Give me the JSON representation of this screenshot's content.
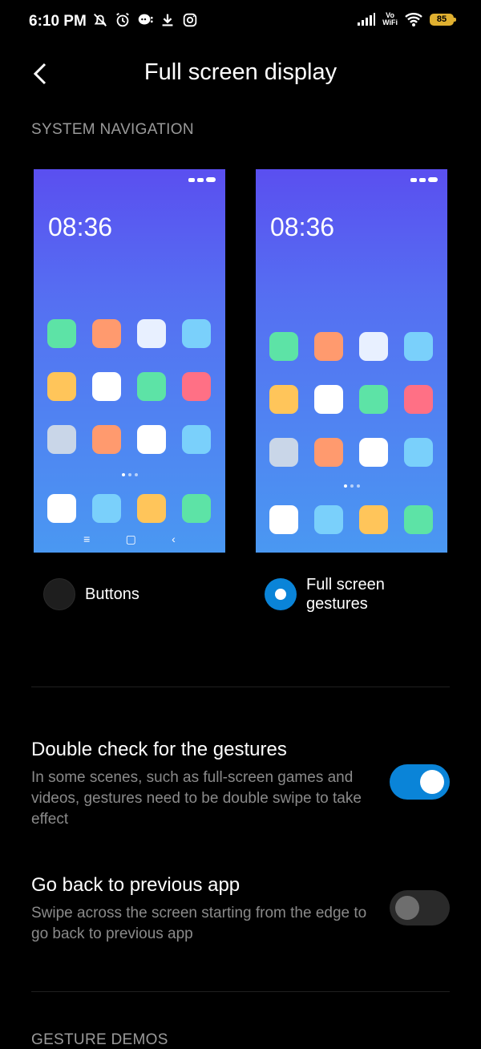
{
  "status_bar": {
    "time": "6:10 PM",
    "left_icons": [
      "mute-notifications-icon",
      "alarm-icon",
      "chat-icon",
      "download-icon",
      "instagram-icon"
    ],
    "vowifi_top": "Vo",
    "vowifi_bottom": "WiFi",
    "battery": "85",
    "colors": {
      "battery": "#e0b030"
    }
  },
  "header": {
    "back_icon": "chevron-left-icon",
    "title": "Full screen display"
  },
  "system_navigation": {
    "label": "SYSTEM NAVIGATION",
    "previews": [
      {
        "clock": "08:36",
        "nav_keys": [
          "≡",
          "▢",
          "‹"
        ]
      },
      {
        "clock": "08:36"
      }
    ],
    "options": [
      {
        "label": "Buttons",
        "selected": false
      },
      {
        "label_line1": "Full screen",
        "label_line2": "gestures",
        "selected": true
      }
    ]
  },
  "settings": [
    {
      "title": "Double check for the gestures",
      "description": "In some scenes, such as full-screen games and videos, gestures need to be double swipe to take effect",
      "enabled": true
    },
    {
      "title": "Go back to previous app",
      "description": "Swipe across the screen starting from the edge to go back to previous app",
      "enabled": false
    }
  ],
  "gesture_demos": {
    "label": "GESTURE DEMOS"
  },
  "colors": {
    "accent": "#0a84d8",
    "background": "#000000",
    "secondary_text": "#8a8a8a"
  },
  "app_icon_colors": [
    "#5de3a6",
    "#ff9a6e",
    "#e8f0ff",
    "#7ad0fb",
    "#ffc55a",
    "#ffffff",
    "#5de3a6",
    "#ff7085",
    "#c9d6e8",
    "#ff9a6e",
    "#ffffff",
    "#7ad0fb",
    "#ffffff",
    "#7ad0fb",
    "#ffc55a",
    "#5de3a6"
  ]
}
